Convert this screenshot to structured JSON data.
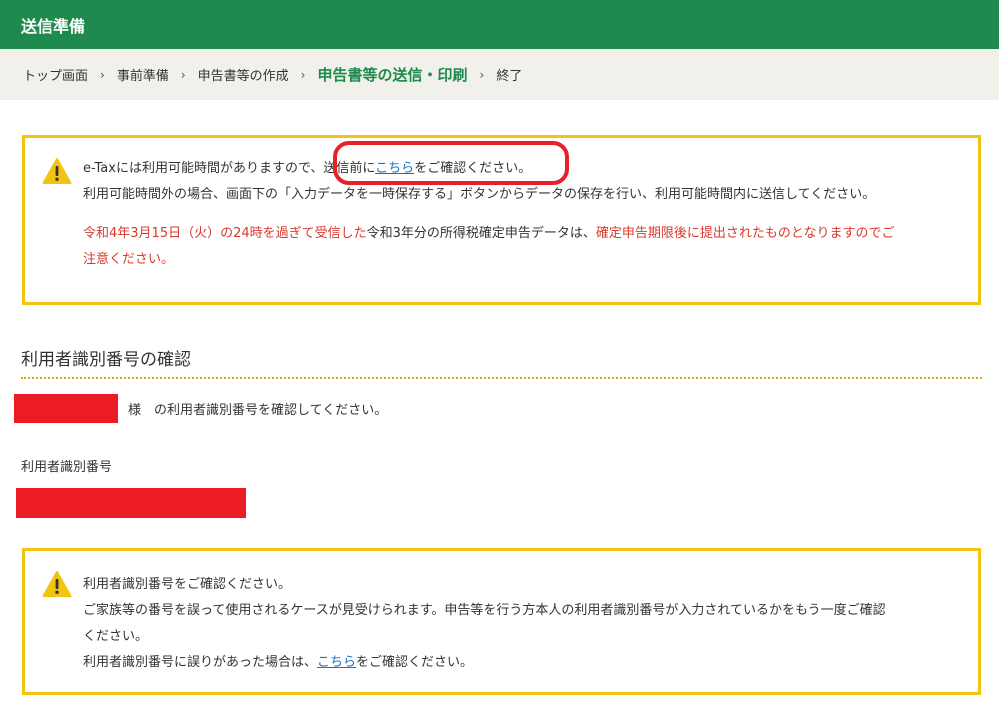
{
  "header": {
    "title": "送信準備"
  },
  "breadcrumb": {
    "items": [
      "トップ画面",
      "申告書等の作成",
      "申告書等の送信・印刷",
      "終了"
    ],
    "items_full": [
      "トップ画面",
      "事前準備",
      "申告書等の作成",
      "申告書等の送信・印刷",
      "終了"
    ],
    "separator": "›",
    "current_index": 3
  },
  "notice1": {
    "line1_before": "e-Taxには利用可能時間がありますので、送信前に",
    "line1_link": "こちら",
    "line1_after": "をご確認ください。",
    "line2": "利用可能時間外の場合、画面下の「入力データを一時保存する」ボタンからデータの保存を行い、利用可能時間内に送信してください。",
    "red1": "令和4年3月15日（火）の24時を過ぎて受信した",
    "black_mid": "令和3年分の所得税確定申告データは、",
    "red2": "確定申告期限後に提出されたものとなりますのでご",
    "red3": "注意ください。"
  },
  "identity": {
    "section_title": "利用者識別番号の確認",
    "name_suffix": "様　の利用者識別番号を確認してください。",
    "field_label": "利用者識別番号"
  },
  "notice2": {
    "line1": "利用者識別番号をご確認ください。",
    "line2": "ご家族等の番号を誤って使用されるケースが見受けられます。申告等を行う方本人の利用者識別番号が入力されているかをもう一度ご確認",
    "line3": "ください。",
    "line4_before": "利用者識別番号に誤りがあった場合は、",
    "line4_link": "こちら",
    "line4_after": "をご確認ください。"
  },
  "colors": {
    "header_green": "#1e8a4e",
    "notice_border": "#f1c40f",
    "warning_red": "#d83a2c",
    "link_blue": "#1a6fc0",
    "redaction": "#ed1c24"
  }
}
